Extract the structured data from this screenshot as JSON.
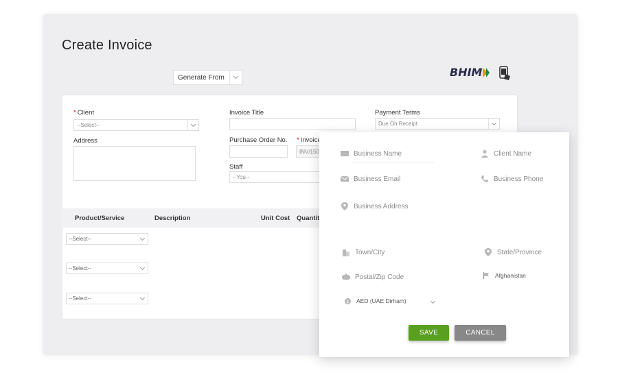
{
  "page": {
    "title": "Create Invoice",
    "generate_from": "Generate From",
    "bhim_logo": "BHIM"
  },
  "form": {
    "client_label": "Client",
    "client_placeholder": "--Select--",
    "address_label": "Address",
    "invoice_title_label": "Invoice Title",
    "payment_terms_label": "Payment Terms",
    "payment_terms_value": "Due On Receipt",
    "po_label": "Purchase Order No.",
    "invoice_no_label": "Invoice",
    "invoice_no_value": "INV/150",
    "staff_label": "Staff",
    "staff_value": "--You--"
  },
  "table": {
    "headers": [
      "Product/Service",
      "Description",
      "Unit Cost",
      "Quantit"
    ],
    "rows": [
      "--Select--",
      "--Select--",
      "--Select--"
    ]
  },
  "modal": {
    "business_name": "Business Name",
    "client_name": "Client Name",
    "business_email": "Business Email",
    "business_phone": "Business Phone",
    "business_address": "Business Address",
    "town_city": "Town/City",
    "state_province": "State/Province",
    "postal_zip": "Postal/Zip Code",
    "country": "Afghanistan",
    "currency": "AED (UAE Dirham)",
    "save_label": "SAVE",
    "cancel_label": "CANCEL"
  },
  "colors": {
    "save": "#5aa020",
    "cancel": "#888888",
    "bhim_orange": "#f29200",
    "bhim_green": "#1e8a3c"
  }
}
